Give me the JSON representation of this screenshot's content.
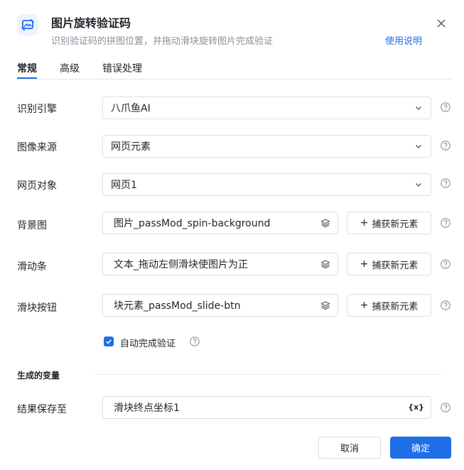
{
  "header": {
    "title": "图片旋转验证码",
    "subtitle": "识别验证码的拼图位置，并拖动滑块旋转图片完成验证",
    "help_link": "使用说明",
    "icon": "rotate-captcha-icon",
    "close_icon": "close-icon"
  },
  "tabs": [
    {
      "label": "常规",
      "active": true
    },
    {
      "label": "高级",
      "active": false
    },
    {
      "label": "错误处理",
      "active": false
    }
  ],
  "form": {
    "engine": {
      "label": "识别引擎",
      "value": "八爪鱼AI"
    },
    "image_source": {
      "label": "图像来源",
      "value": "网页元素"
    },
    "web_object": {
      "label": "网页对象",
      "value": "网页1"
    },
    "background": {
      "label": "背景图",
      "value": "图片_passMod_spin-background",
      "capture": "捕获新元素"
    },
    "slider_bar": {
      "label": "滑动条",
      "value": "文本_拖动左侧滑块使图片为正",
      "capture": "捕获新元素"
    },
    "slider_button": {
      "label": "滑块按钮",
      "value": "块元素_passMod_slide-btn",
      "capture": "捕获新元素"
    },
    "auto_verify": {
      "label": "自动完成验证",
      "checked": true
    }
  },
  "variables": {
    "section_title": "生成的变量",
    "result": {
      "label": "结果保存至",
      "value": "滑块终点坐标1",
      "badge": "{x}"
    }
  },
  "footer": {
    "cancel": "取消",
    "confirm": "确定"
  },
  "colors": {
    "accent": "#1e6fe6",
    "border": "#dcdfe6",
    "muted_text": "#8a8f99"
  }
}
